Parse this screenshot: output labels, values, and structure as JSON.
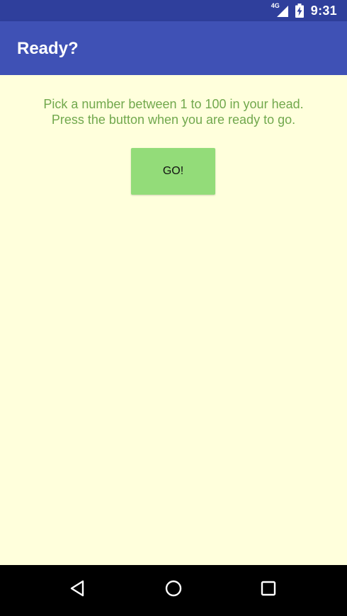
{
  "status_bar": {
    "network": "4G",
    "time": "9:31",
    "icons": [
      "signal-icon",
      "battery-charging-icon"
    ]
  },
  "app_bar": {
    "title": "Ready?"
  },
  "main": {
    "instruction_line1": "Pick a number between 1 to 100 in your head.",
    "instruction_line2": "Press the button when you are ready to go.",
    "go_label": "GO!"
  },
  "nav_bar": {
    "icons": [
      "back-icon",
      "home-icon",
      "recents-icon"
    ]
  },
  "colors": {
    "status_bar": "#2f3f9c",
    "app_bar": "#3f51b5",
    "background": "#ffffdc",
    "instruction_text": "#71a84d",
    "button": "#93dc79",
    "nav_bar": "#000000"
  }
}
